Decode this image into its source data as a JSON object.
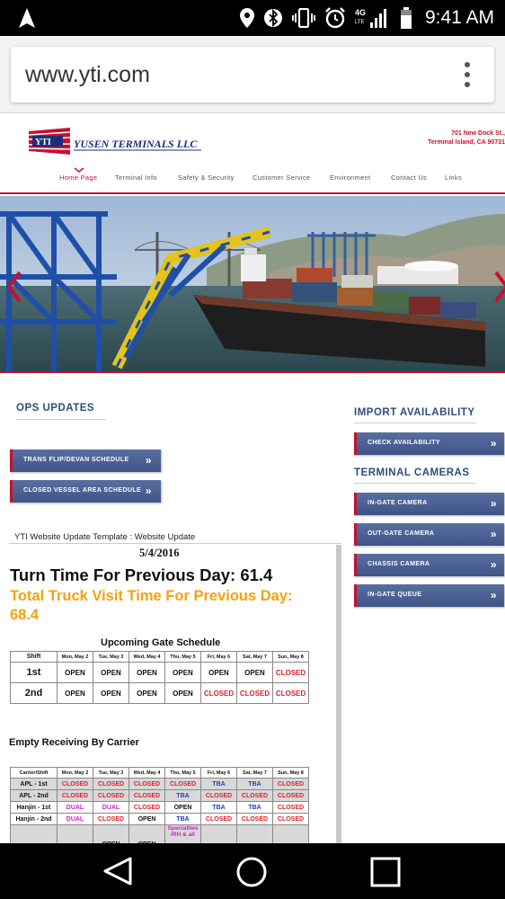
{
  "status_bar": {
    "time": "9:41 AM",
    "network": "4G LTE",
    "icons": [
      "navigation-arrow-icon",
      "location-pin-icon",
      "bluetooth-icon",
      "vibrate-icon",
      "alarm-icon",
      "signal-icon",
      "battery-icon"
    ]
  },
  "browser": {
    "url": "www.yti.com"
  },
  "site": {
    "logo_text": "YUSEN TERMINALS LLC",
    "logo_badge": "YTI",
    "address_line1": "701 New Dock St.,",
    "address_line2": "Terminal Island, CA 90731",
    "nav": [
      "Home Page",
      "Terminal Info",
      "Safety & Security",
      "Customer Service",
      "Environment",
      "Contact Us",
      "Links"
    ],
    "active_nav": "Home Page"
  },
  "ops": {
    "title": "OPS UPDATES",
    "buttons": [
      "TRANS FLIP/DEVAN SCHEDULE",
      "CLOSED VESSEL AREA SCHEDULE"
    ]
  },
  "import": {
    "title": "IMPORT AVAILABILITY",
    "button": "CHECK AVAILABILITY"
  },
  "cameras": {
    "title": "TERMINAL CAMERAS",
    "buttons": [
      "IN-GATE CAMERA",
      "OUT-GATE CAMERA",
      "CHASSIS CAMERA",
      "IN-GATE QUEUE"
    ]
  },
  "update": {
    "frame_title": "YTI Website Update Template : Website Update",
    "date": "5/4/2016",
    "turn_time": "Turn Time For Previous Day: 61.4",
    "total_truck": "Total Truck Visit Time For Previous Day: 68.4"
  },
  "gate_schedule": {
    "title": "Upcoming Gate Schedule",
    "header": [
      "Shift",
      "Mon, May 2",
      "Tue, May 3",
      "Wed, May 4",
      "Thu, May 5",
      "Fri, May 6",
      "Sat, May 7",
      "Sun, May 8"
    ],
    "rows": [
      [
        "1st",
        "OPEN",
        "OPEN",
        "OPEN",
        "OPEN",
        "OPEN",
        "OPEN",
        "CLOSED"
      ],
      [
        "2nd",
        "OPEN",
        "OPEN",
        "OPEN",
        "OPEN",
        "CLOSED",
        "CLOSED",
        "CLOSED"
      ]
    ]
  },
  "empty_receiving": {
    "title": "Empty Receiving By Carrier",
    "header": [
      "Carrier/Shift",
      "Mon, May 2",
      "Tue, May 3",
      "Wed, May 4",
      "Thu, May 5",
      "Fri, May 6",
      "Sat, May 7",
      "Sun, May 8"
    ],
    "rows": [
      [
        "APL - 1st",
        "CLOSED",
        "CLOSED",
        "CLOSED",
        "CLOSED",
        "TBA",
        "TBA",
        "CLOSED"
      ],
      [
        "APL - 2nd",
        "CLOSED",
        "CLOSED",
        "CLOSED",
        "TBA",
        "CLOSED",
        "CLOSED",
        "CLOSED"
      ],
      [
        "Hanjin - 1st",
        "DUAL",
        "DUAL",
        "CLOSED",
        "OPEN",
        "TBA",
        "TBA",
        "CLOSED"
      ],
      [
        "Hanjin - 2nd",
        "DUAL",
        "CLOSED",
        "OPEN",
        "TBA",
        "CLOSED",
        "CLOSED",
        "CLOSED"
      ],
      [
        "",
        "",
        "OPEN",
        "OPEN",
        "Specialties /RH & all",
        "",
        "",
        ""
      ]
    ]
  },
  "android_nav": [
    "back-icon",
    "home-icon",
    "recents-icon"
  ]
}
